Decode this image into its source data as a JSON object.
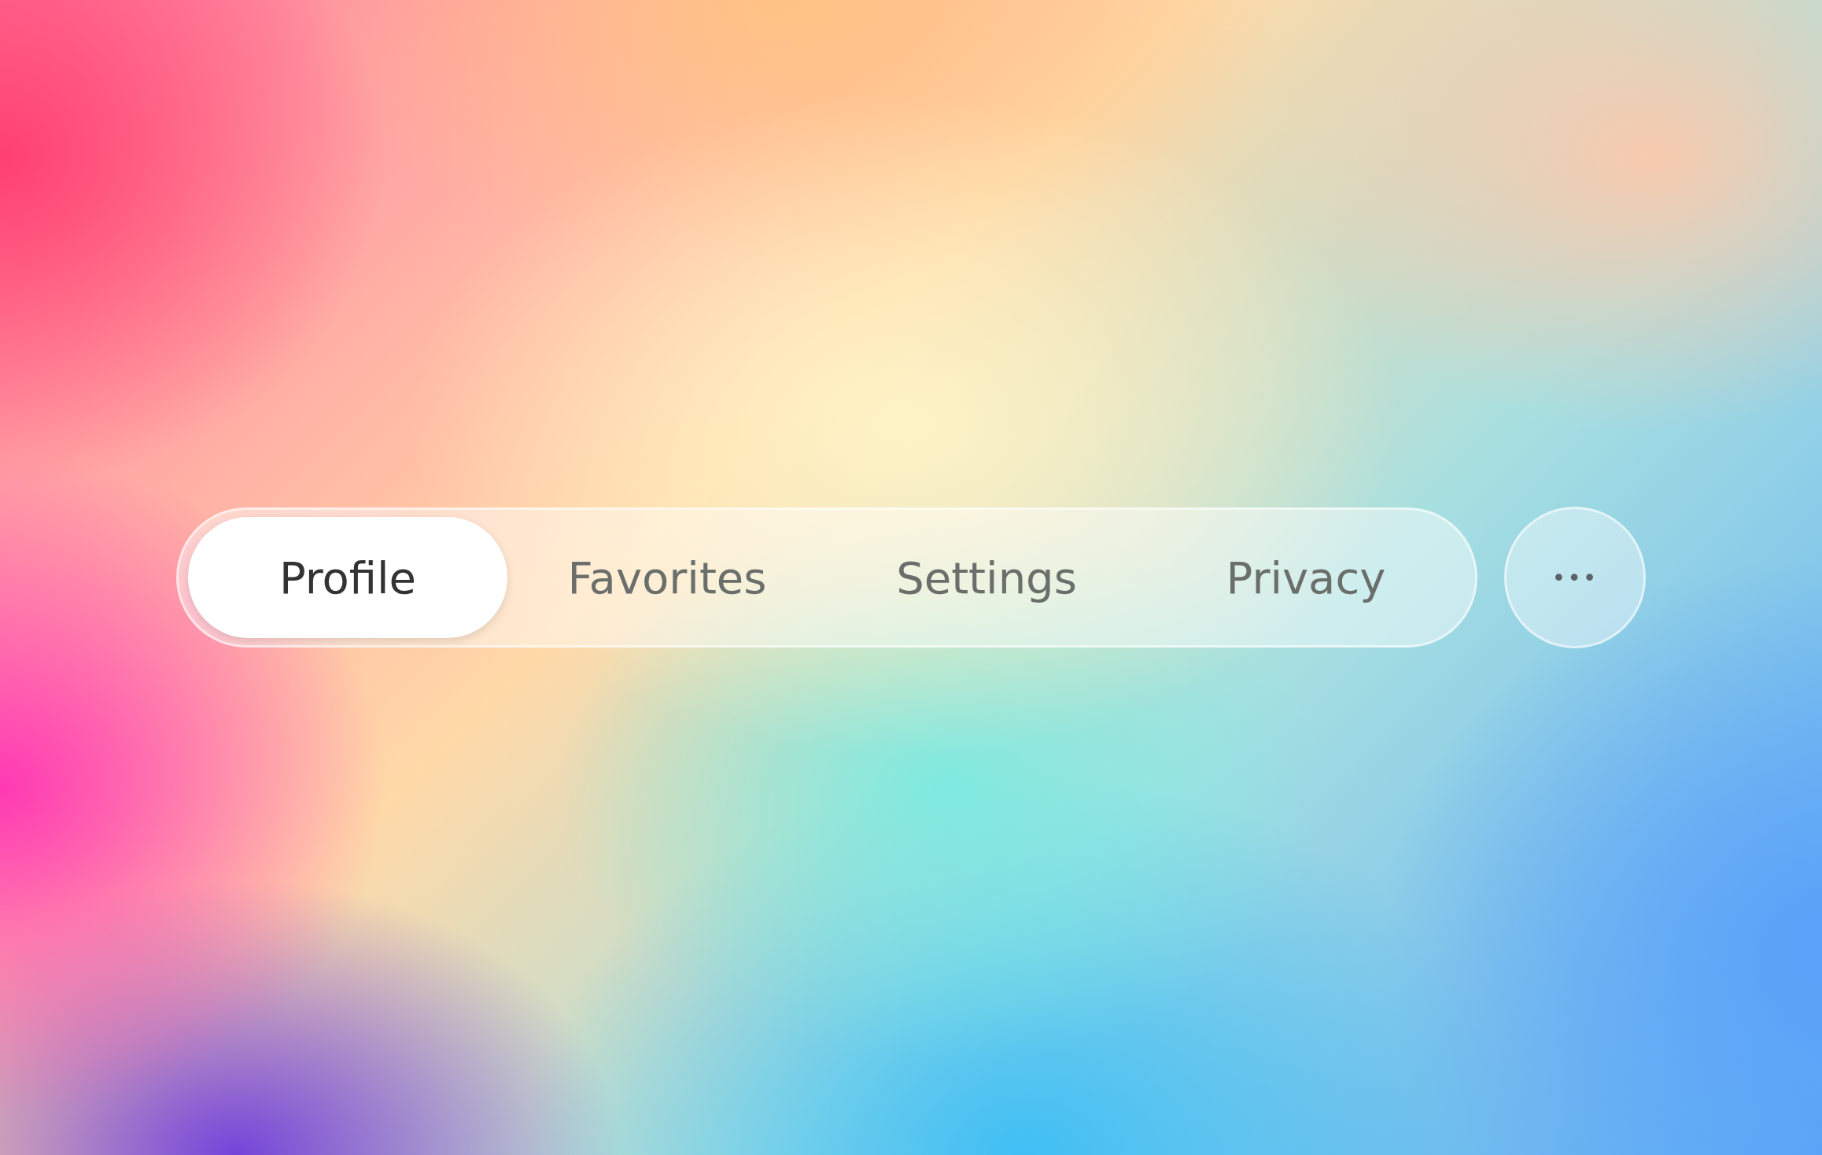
{
  "tabs": [
    {
      "label": "Profile",
      "selected": true
    },
    {
      "label": "Favorites",
      "selected": false
    },
    {
      "label": "Settings",
      "selected": false
    },
    {
      "label": "Privacy",
      "selected": false
    }
  ],
  "more_button": {
    "label": "•••"
  }
}
